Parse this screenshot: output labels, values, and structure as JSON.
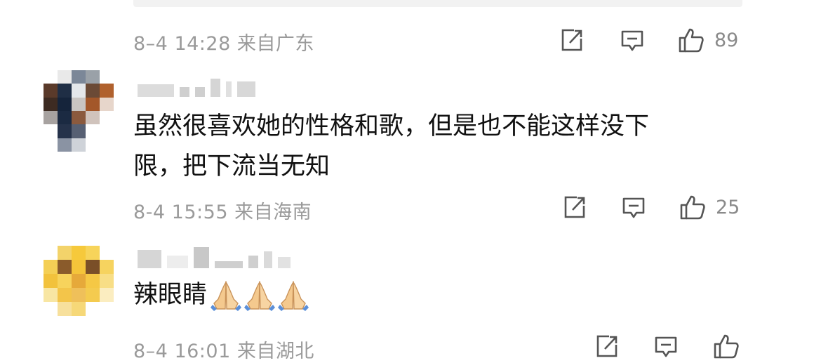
{
  "comments": [
    {
      "meta": "8–4 14:28  来自广东",
      "like_count": "89"
    },
    {
      "username": "",
      "text_line1": "虽然很喜欢她的性格和歌，但是也不能这样没下",
      "text_line2": "限，把下流当无知",
      "meta": "8-4 15:55  来自海南",
      "like_count": "25"
    },
    {
      "username": "",
      "text": "辣眼睛",
      "emoji": "🙏🙏🙏",
      "meta": "8–4 16:01  来自湖北",
      "like_count": ""
    }
  ],
  "icons": {
    "share": "share-icon",
    "reply": "comment-icon",
    "like": "thumbs-up-icon"
  },
  "colors": {
    "meta_text": "#9a9a9a",
    "icon_stroke": "#555555",
    "emoji_sleeve": "#5b8fd8",
    "emoji_hand": "#f4c98e"
  }
}
